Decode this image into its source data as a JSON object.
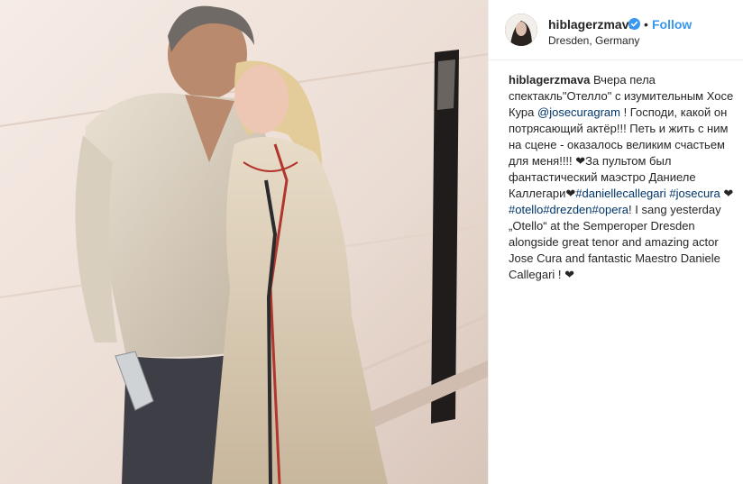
{
  "post": {
    "username": "hiblagerzmava",
    "follow_label": "Follow",
    "separator": "•",
    "location": "Dresden, Germany",
    "verified": true,
    "icons": {
      "verified": "verified-badge-icon",
      "avatar": "profile-avatar"
    },
    "colors": {
      "follow": "#3897f0",
      "link": "#003569",
      "verified": "#3897f0"
    }
  },
  "caption": {
    "author": "hiblagerzmava",
    "t1": " Вчера пела спектакль\"Отелло\" с изумительным Хосе Кура ",
    "mention_jose": "@josecuragram",
    "t2": " ! Господи, какой он потрясающий актёр!!! Петь и жить с ним на сцене - оказалось великим счастьем для меня!!!! ❤За пультом был фантастический маэстро Даниеле Каллегари❤",
    "tag_daniele": "#daniellecallegari",
    "sp1": " ",
    "tag_josecura": "#josecura",
    "t3": " ❤",
    "tag_otello": "#otello",
    "tag_drezden": "#drezden",
    "tag_opera": "#opera",
    "t4": "! I sang yesterday „Otello“ at the Semperoper Dresden alongside great tenor and amazing actor Jose Cura and fantastic Maestro Daniele Callegari ! ❤"
  }
}
